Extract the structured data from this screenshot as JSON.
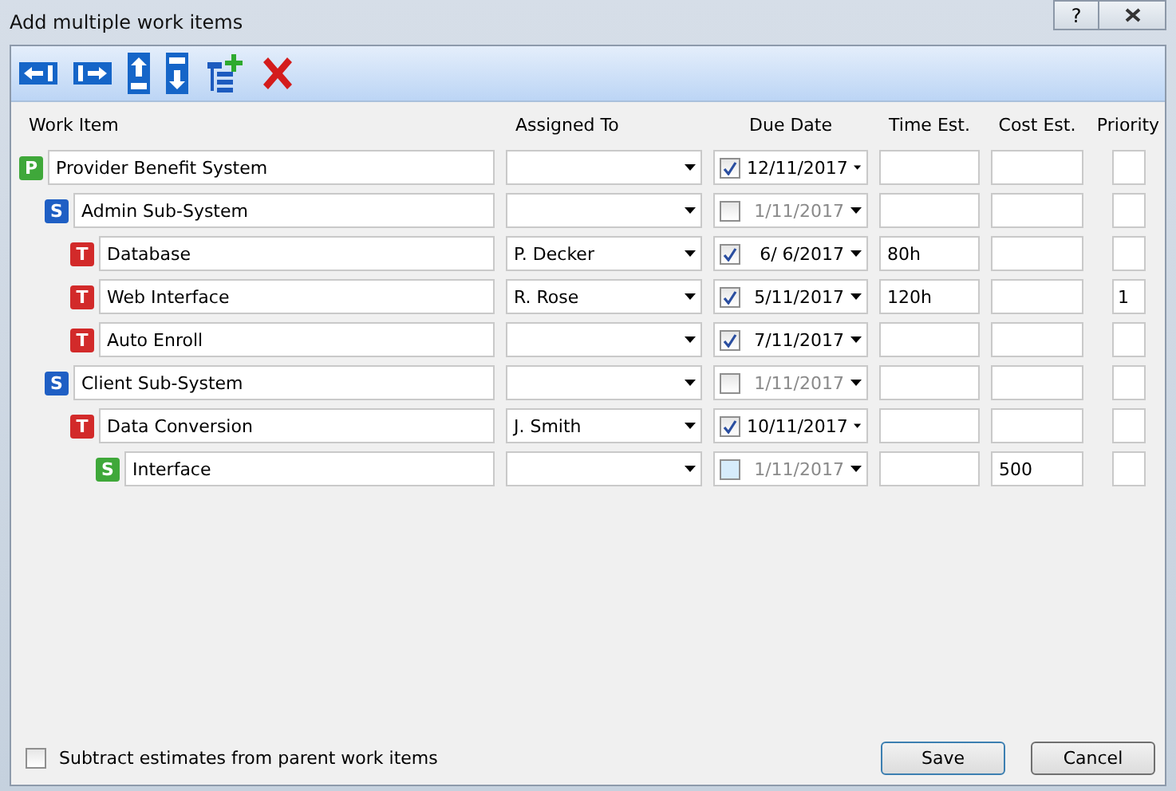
{
  "window": {
    "title": "Add multiple work items",
    "help_label": "?"
  },
  "columns": [
    "Work Item",
    "Assigned To",
    "Due Date",
    "Time Est.",
    "Cost Est.",
    "Priority"
  ],
  "items": [
    {
      "badge": "P",
      "color": "#3fa83a",
      "name": "Provider Benefit System",
      "due_checked": true,
      "due": "12/11/2017",
      "children": [
        {
          "badge": "S",
          "color": "#1f5fc4",
          "name": "Admin Sub-System",
          "due_checked": false,
          "due": "1/11/2017",
          "children": [
            {
              "badge": "T",
              "color": "#d22a2a",
              "name": "Database",
              "assigned": "P. Decker",
              "due_checked": true,
              "due": "6/  6/2017",
              "time": "80h"
            },
            {
              "badge": "T",
              "color": "#d22a2a",
              "name": "Web Interface",
              "assigned": "R. Rose",
              "due_checked": true,
              "due": "5/11/2017",
              "time": "120h",
              "priority": "1"
            },
            {
              "badge": "T",
              "color": "#d22a2a",
              "name": "Auto Enroll",
              "due_checked": true,
              "due": "7/11/2017"
            }
          ]
        },
        {
          "badge": "S",
          "color": "#1f5fc4",
          "name": "Client Sub-System",
          "due_checked": false,
          "due": "1/11/2017",
          "children": [
            {
              "badge": "T",
              "color": "#d22a2a",
              "name": "Data Conversion",
              "assigned": "J. Smith",
              "due_checked": true,
              "due": "10/11/2017",
              "children": [
                {
                  "badge": "S",
                  "color": "#3fa83a",
                  "name": "Interface",
                  "due_checked": false,
                  "due": "1/11/2017",
                  "cost": "500"
                }
              ]
            }
          ]
        }
      ]
    }
  ],
  "subtract": {
    "label": "Subtract estimates from parent work items",
    "checked": false
  },
  "buttons": [
    "Save",
    "Cancel"
  ]
}
